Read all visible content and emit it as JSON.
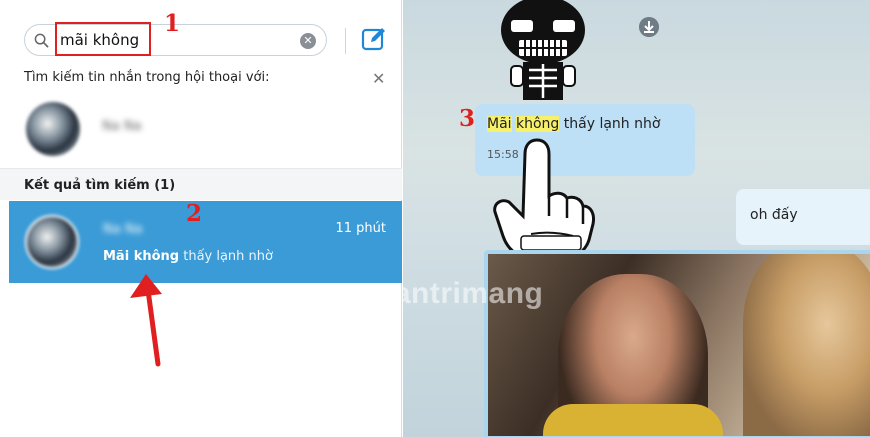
{
  "search": {
    "query": "mãi không",
    "hint": "Tìm kiếm tin nhắn trong hội thoại với:"
  },
  "contact": {
    "name": "Na Na"
  },
  "results": {
    "header": "Kết quả tìm kiếm (1)",
    "item": {
      "name": "Na Na",
      "time": "11 phút",
      "snippet_bold": "Mãi không",
      "snippet_rest": " thấy lạnh nhờ"
    }
  },
  "chat": {
    "message": {
      "hl1": "Mãi",
      "hl2": "không",
      "rest": " thấy lạnh nhờ",
      "time": "15:58"
    },
    "reply": "oh đấy"
  },
  "annotations": {
    "n1": "1",
    "n2": "2",
    "n3": "3"
  },
  "watermark": "uantrimang",
  "colors": {
    "accent": "#3b9bd6",
    "annotation_red": "#e02020",
    "highlight": "#f7f06a",
    "bubble": "#bde0f7"
  }
}
